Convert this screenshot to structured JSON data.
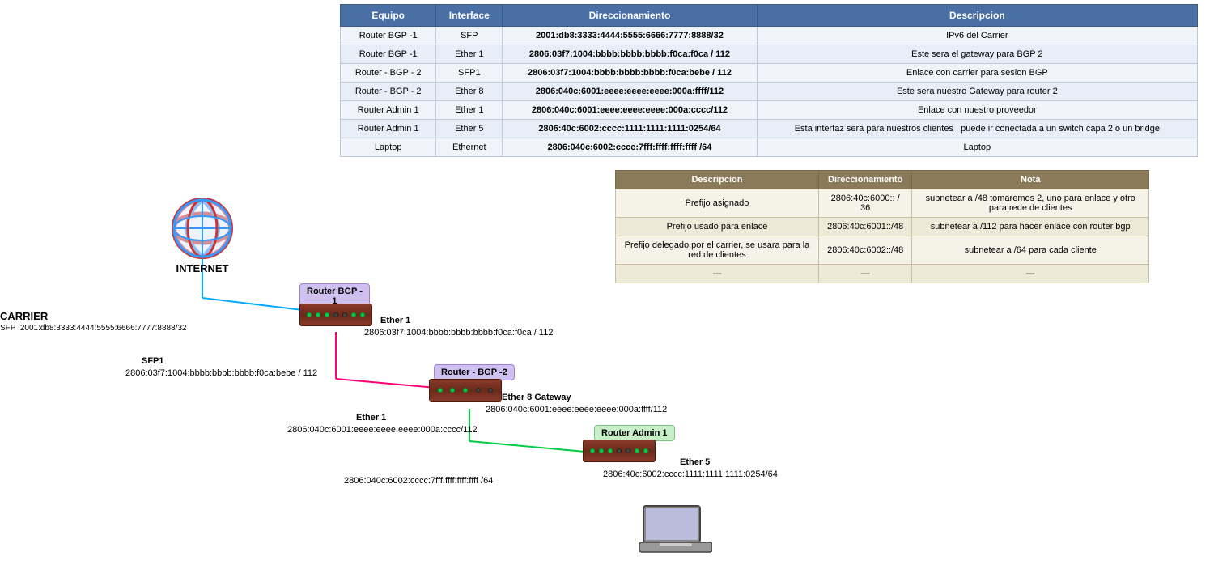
{
  "table": {
    "headers": [
      "Equipo",
      "Interface",
      "Direccionamiento",
      "Descripcion"
    ],
    "rows": [
      {
        "equipo": "Router BGP -1",
        "interface": "SFP",
        "direccionamiento": "2001:db8:3333:4444:5555:6666:7777:8888/32",
        "descripcion": "IPv6 del Carrier"
      },
      {
        "equipo": "Router BGP -1",
        "interface": "Ether 1",
        "direccionamiento": "2806:03f7:1004:bbbb:bbbb:bbbb:f0ca:f0ca / 112",
        "descripcion": "Este sera el gateway para BGP 2"
      },
      {
        "equipo": "Router - BGP - 2",
        "interface": "SFP1",
        "direccionamiento": "2806:03f7:1004:bbbb:bbbb:bbbb:f0ca:bebe / 112",
        "descripcion": "Enlace con carrier para sesion BGP"
      },
      {
        "equipo": "Router - BGP - 2",
        "interface": "Ether 8",
        "direccionamiento": "2806:040c:6001:eeee:eeee:eeee:000a:ffff/112",
        "descripcion": "Este sera nuestro Gateway para router 2"
      },
      {
        "equipo": "Router Admin 1",
        "interface": "Ether 1",
        "direccionamiento": "2806:040c:6001:eeee:eeee:eeee:000a:cccc/112",
        "descripcion": "Enlace con nuestro proveedor"
      },
      {
        "equipo": "Router Admin 1",
        "interface": "Ether 5",
        "direccionamiento": "2806:40c:6002:cccc:1111:1111:1111:0254/64",
        "descripcion": "Esta interfaz sera para nuestros clientes , puede ir conectada a un switch capa 2 o un bridge"
      },
      {
        "equipo": "Laptop",
        "interface": "Ethernet",
        "direccionamiento": "2806:040c:6002:cccc:7fff:ffff:ffff:ffff /64",
        "descripcion": "Laptop"
      }
    ]
  },
  "sub_table": {
    "headers": [
      "Descripcion",
      "Direccionamiento",
      "Nota"
    ],
    "rows": [
      {
        "descripcion": "Prefijo asignado",
        "direccionamiento": "2806:40c:6000:: / 36",
        "nota": "subnetear a /48  tomaremos 2, uno para enlace y otro para rede de clientes"
      },
      {
        "descripcion": "Prefijo usado para enlace",
        "direccionamiento": "2806:40c:6001::/48",
        "nota": "subnetear a /112 para hacer enlace con router bgp"
      },
      {
        "descripcion": "Prefijo delegado por el carrier, se usara para la red de clientes",
        "direccionamiento": "2806:40c:6002::/48",
        "nota": "subnetear a /64 para cada cliente"
      },
      {
        "descripcion": "—",
        "direccionamiento": "—",
        "nota": "—"
      }
    ]
  },
  "diagram": {
    "internet_label": "INTERNET",
    "carrier_label": "CARRIER",
    "carrier_ip": "SFP :2001:db8:3333:4444:5555:6666:7777:8888/32",
    "router_bgp1_label": "Router BGP -\n1",
    "router_bgp1_ether1_label": "Ether 1",
    "router_bgp1_ether1_ip": "2806:03f7:1004:bbbb:bbbb:bbbb:f0ca:f0ca / 112",
    "router_bgp2_label": "Router - BGP -2",
    "router_bgp2_sfp1_label": "SFP1",
    "router_bgp2_sfp1_ip": "2806:03f7:1004:bbbb:bbbb:bbbb:f0ca:bebe / 112",
    "router_bgp2_ether8_label": "Ether 8 Gateway",
    "router_bgp2_ether8_ip": "2806:040c:6001:eeee:eeee:eeee:000a:ffff/112",
    "router_admin1_label": "Router Admin 1",
    "router_admin1_ether1_label": "Ether 1",
    "router_admin1_ether1_ip": "2806:040c:6001:eeee:eeee:eeee:000a:cccc/112",
    "router_admin1_ether5_label": "Ether 5",
    "router_admin1_ether5_ip": "2806:40c:6002:cccc:1111:1111:1111:0254/64",
    "laptop_ip": "2806:040c:6002:cccc:7fff:ffff:ffff:ffff /64"
  }
}
